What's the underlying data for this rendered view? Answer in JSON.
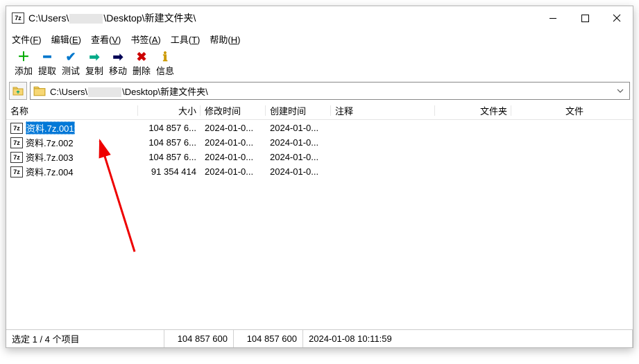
{
  "window": {
    "title_prefix": "C:\\Users\\",
    "title_suffix": "\\Desktop\\新建文件夹\\"
  },
  "menu": {
    "file": "文件(F)",
    "edit": "编辑(E)",
    "view": "查看(V)",
    "bookmarks": "书签(A)",
    "tools": "工具(T)",
    "help": "帮助(H)"
  },
  "toolbar": {
    "add": "添加",
    "extract": "提取",
    "test": "测试",
    "copy": "复制",
    "move": "移动",
    "delete": "删除",
    "info": "信息"
  },
  "address": {
    "path_prefix": "C:\\Users\\",
    "path_suffix": "\\Desktop\\新建文件夹\\"
  },
  "columns": {
    "name": "名称",
    "size": "大小",
    "mtime": "修改时间",
    "ctime": "创建时间",
    "comment": "注释",
    "folder": "文件夹",
    "file": "文件"
  },
  "files": [
    {
      "name": "资料.7z.001",
      "size": "104 857 6...",
      "mtime": "2024-01-0...",
      "ctime": "2024-01-0...",
      "selected": true
    },
    {
      "name": "资料.7z.002",
      "size": "104 857 6...",
      "mtime": "2024-01-0...",
      "ctime": "2024-01-0...",
      "selected": false
    },
    {
      "name": "资料.7z.003",
      "size": "104 857 6...",
      "mtime": "2024-01-0...",
      "ctime": "2024-01-0...",
      "selected": false
    },
    {
      "name": "资料.7z.004",
      "size": "91 354 414",
      "mtime": "2024-01-0...",
      "ctime": "2024-01-0...",
      "selected": false
    }
  ],
  "status": {
    "selection": "选定 1 / 4 个项目",
    "size1": "104 857 600",
    "size2": "104 857 600",
    "date": "2024-01-08 10:11:59"
  }
}
